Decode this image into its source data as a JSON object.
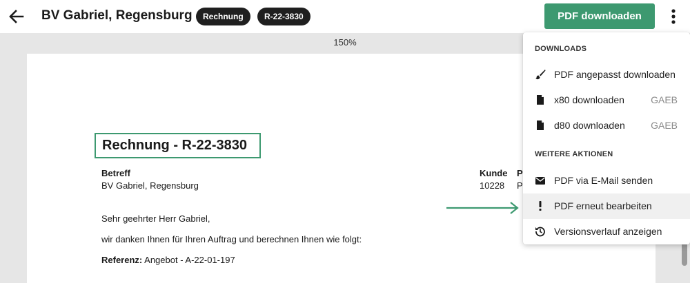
{
  "header": {
    "title": "BV Gabriel, Regensburg",
    "badge_type": "Rechnung",
    "badge_number": "R-22-3830",
    "pdf_button_label": "PDF downloaden"
  },
  "viewer": {
    "zoom": "150%"
  },
  "document": {
    "heading": "Rechnung - R-22-3830",
    "betreff_label": "Betreff",
    "betreff_value": "BV Gabriel, Regensburg",
    "kunde_label": "Kunde",
    "kunde_value": "10228",
    "extra_label": "P",
    "extra_value": "P",
    "salutation": "Sehr geehrter Herr Gabriel,",
    "intro": "wir danken Ihnen für Ihren Auftrag und berechnen Ihnen wie folgt:",
    "referenz_label": "Referenz:",
    "referenz_value": "Angebot - A-22-01-197"
  },
  "menu": {
    "section_downloads": "DOWNLOADS",
    "section_more": "WEITERE AKTIONEN",
    "items": [
      {
        "label": "PDF angepasst downloaden",
        "tag": "",
        "icon": "brush-icon"
      },
      {
        "label": "x80 downloaden",
        "tag": "GAEB",
        "icon": "file-icon"
      },
      {
        "label": "d80 downloaden",
        "tag": "GAEB",
        "icon": "file-icon"
      },
      {
        "label": "PDF via E-Mail senden",
        "tag": "",
        "icon": "envelope-icon"
      },
      {
        "label": "PDF erneut bearbeiten",
        "tag": "",
        "icon": "exclamation-icon"
      },
      {
        "label": "Versionsverlauf anzeigen",
        "tag": "",
        "icon": "history-icon"
      }
    ]
  },
  "colors": {
    "accent": "#3d9970",
    "badge_bg": "#1f1f1f",
    "viewer_bg": "#e6e6e6",
    "highlight": "#f0f0f0"
  }
}
